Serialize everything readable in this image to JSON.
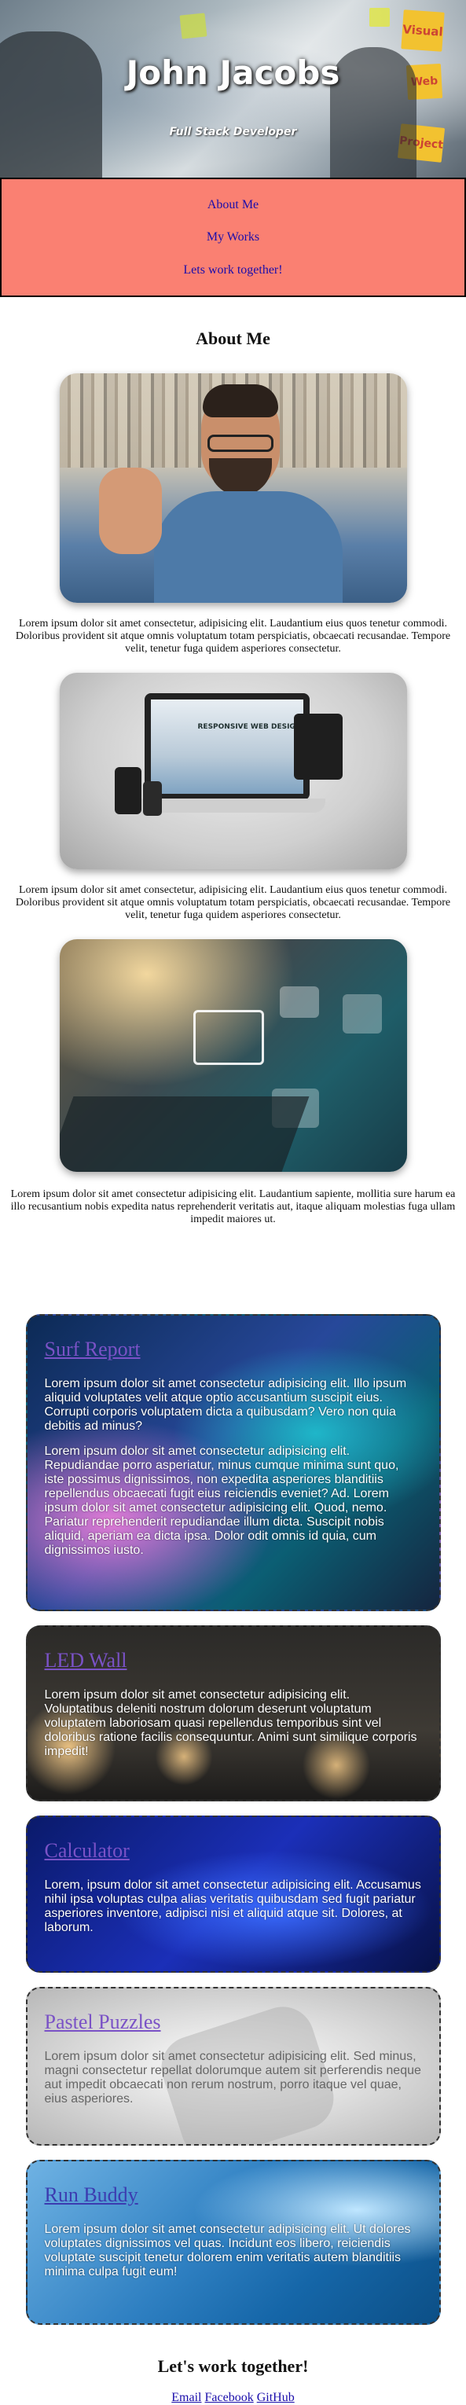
{
  "header": {
    "name": "John Jacobs",
    "role": "Full Stack Developer",
    "board_notes": [
      "Visual",
      "Web",
      "Project"
    ]
  },
  "nav": {
    "items": [
      "About Me",
      "My Works",
      "Lets work together!"
    ]
  },
  "about": {
    "title": "About Me",
    "captions": [
      "Lorem ipsum dolor sit amet consectetur, adipisicing elit. Laudantium eius quos tenetur commodi. Doloribus provident sit atque omnis voluptatum totam perspiciatis, obcaecati recusandae. Tempore velit, tenetur fuga quidem asperiores consectetur.",
      "Lorem ipsum dolor sit amet consectetur, adipisicing elit. Laudantium eius quos tenetur commodi. Doloribus provident sit atque omnis voluptatum totam perspiciatis, obcaecati recusandae. Tempore velit, tenetur fuga quidem asperiores consectetur.",
      "Lorem ipsum dolor sit amet consectetur adipisicing elit. Laudantium sapiente, mollitia sure harum ea illo recusantium nobis expedita natus reprehenderit veritatis aut, itaque aliquam molestias fuga ullam impedit maiores ut."
    ],
    "laptop_screen_text": "RESPONSIVE WEB DESIGN"
  },
  "works": [
    {
      "title": "Surf Report",
      "paragraphs": [
        "Lorem ipsum dolor sit amet consectetur adipisicing elit. Illo ipsum aliquid voluptates velit atque optio accusantium suscipit eius. Corrupti corporis voluptatem dicta a quibusdam? Vero non quia debitis ad minus?",
        "Lorem ipsum dolor sit amet consectetur adipisicing elit. Repudiandae porro asperiatur, minus cumque minima sunt quo, iste possimus dignissimos, non expedita asperiores blanditiis repellendus obcaecati fugit eius reiciendis eveniet? Ad. Lorem ipsum dolor sit amet consectetur adipisicing elit. Quod, nemo. Pariatur reprehenderit repudiandae illum dicta. Suscipit nobis aliquid, aperiam ea dicta ipsa. Dolor odit omnis id quia, cum dignissimos iusto."
      ]
    },
    {
      "title": "LED Wall",
      "paragraphs": [
        "Lorem ipsum dolor sit amet consectetur adipisicing elit. Voluptatibus deleniti nostrum dolorum deserunt voluptatum voluptatem laboriosam quasi repellendus temporibus sint vel doloribus ratione facilis consequuntur. Animi sunt similique corporis impedit!"
      ]
    },
    {
      "title": "Calculator",
      "paragraphs": [
        "Lorem, ipsum dolor sit amet consectetur adipisicing elit. Accusamus nihil ipsa voluptas culpa alias veritatis quibusdam sed fugit pariatur asperiores inventore, adipisci nisi et aliquid atque sit. Dolores, at laborum."
      ]
    },
    {
      "title": "Pastel Puzzles",
      "paragraphs": [
        "Lorem ipsum dolor sit amet consectetur adipisicing elit. Sed minus, magni consectetur repellat dolorumque autem sit perferendis neque aut impedit obcaecati non rerum nostrum, porro itaque vel quae, eius asperiores."
      ]
    },
    {
      "title": "Run Buddy",
      "paragraphs": [
        "Lorem ipsum dolor sit amet consectetur adipisicing elit. Ut dolores voluptates dignissimos vel quas. Incidunt eos libero, reiciendis voluptate suscipit tenetur dolorem enim veritatis autem blanditiis minima culpa fugit eum!"
      ]
    }
  ],
  "contact": {
    "title": "Let's work together!",
    "links": [
      "Email",
      "Facebook",
      "GitHub"
    ]
  }
}
